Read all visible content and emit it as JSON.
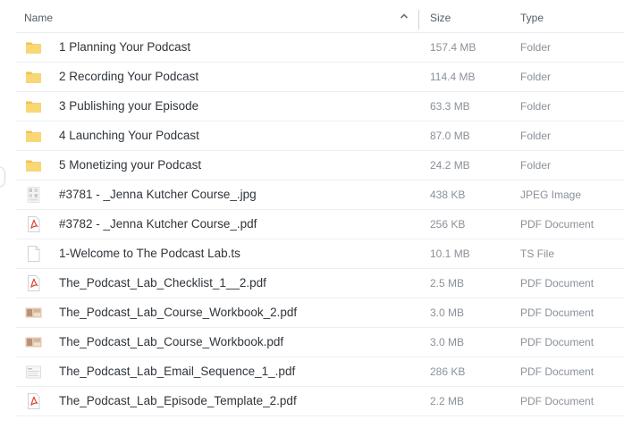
{
  "columns": {
    "name": "Name",
    "size": "Size",
    "type": "Type"
  },
  "sort": {
    "column": "name",
    "direction": "ascending"
  },
  "files": [
    {
      "name": "1 Planning Your Podcast",
      "size": "157.4 MB",
      "type": "Folder",
      "icon": "folder-icon"
    },
    {
      "name": "2 Recording Your Podcast",
      "size": "114.4 MB",
      "type": "Folder",
      "icon": "folder-icon"
    },
    {
      "name": "3 Publishing your Episode",
      "size": "63.3 MB",
      "type": "Folder",
      "icon": "folder-icon"
    },
    {
      "name": "4 Launching Your Podcast",
      "size": "87.0 MB",
      "type": "Folder",
      "icon": "folder-icon"
    },
    {
      "name": "5 Monetizing your Podcast",
      "size": "24.2 MB",
      "type": "Folder",
      "icon": "folder-icon"
    },
    {
      "name": "#3781 - _Jenna Kutcher Course_.jpg",
      "size": "438 KB",
      "type": "JPEG Image",
      "icon": "image-thumbnail-icon"
    },
    {
      "name": "#3782 - _Jenna Kutcher Course_.pdf",
      "size": "256 KB",
      "type": "PDF Document",
      "icon": "pdf-icon"
    },
    {
      "name": "1-Welcome to The Podcast Lab.ts",
      "size": "10.1 MB",
      "type": "TS File",
      "icon": "generic-file-icon"
    },
    {
      "name": "The_Podcast_Lab_Checklist_1__2.pdf",
      "size": "2.5 MB",
      "type": "PDF Document",
      "icon": "pdf-icon"
    },
    {
      "name": "The_Podcast_Lab_Course_Workbook_2.pdf",
      "size": "3.0 MB",
      "type": "PDF Document",
      "icon": "workbook-thumbnail-icon"
    },
    {
      "name": "The_Podcast_Lab_Course_Workbook.pdf",
      "size": "3.0 MB",
      "type": "PDF Document",
      "icon": "workbook-thumbnail-icon"
    },
    {
      "name": "The_Podcast_Lab_Email_Sequence_1_.pdf",
      "size": "286 KB",
      "type": "PDF Document",
      "icon": "document-thumbnail-icon"
    },
    {
      "name": "The_Podcast_Lab_Episode_Template_2.pdf",
      "size": "2.2 MB",
      "type": "PDF Document",
      "icon": "pdf-icon"
    }
  ],
  "colors": {
    "folder": "#f7d26a",
    "pdf": "#e0463a",
    "text": "#2f353b",
    "muted": "#8a9199",
    "divider": "#edf0f2"
  }
}
